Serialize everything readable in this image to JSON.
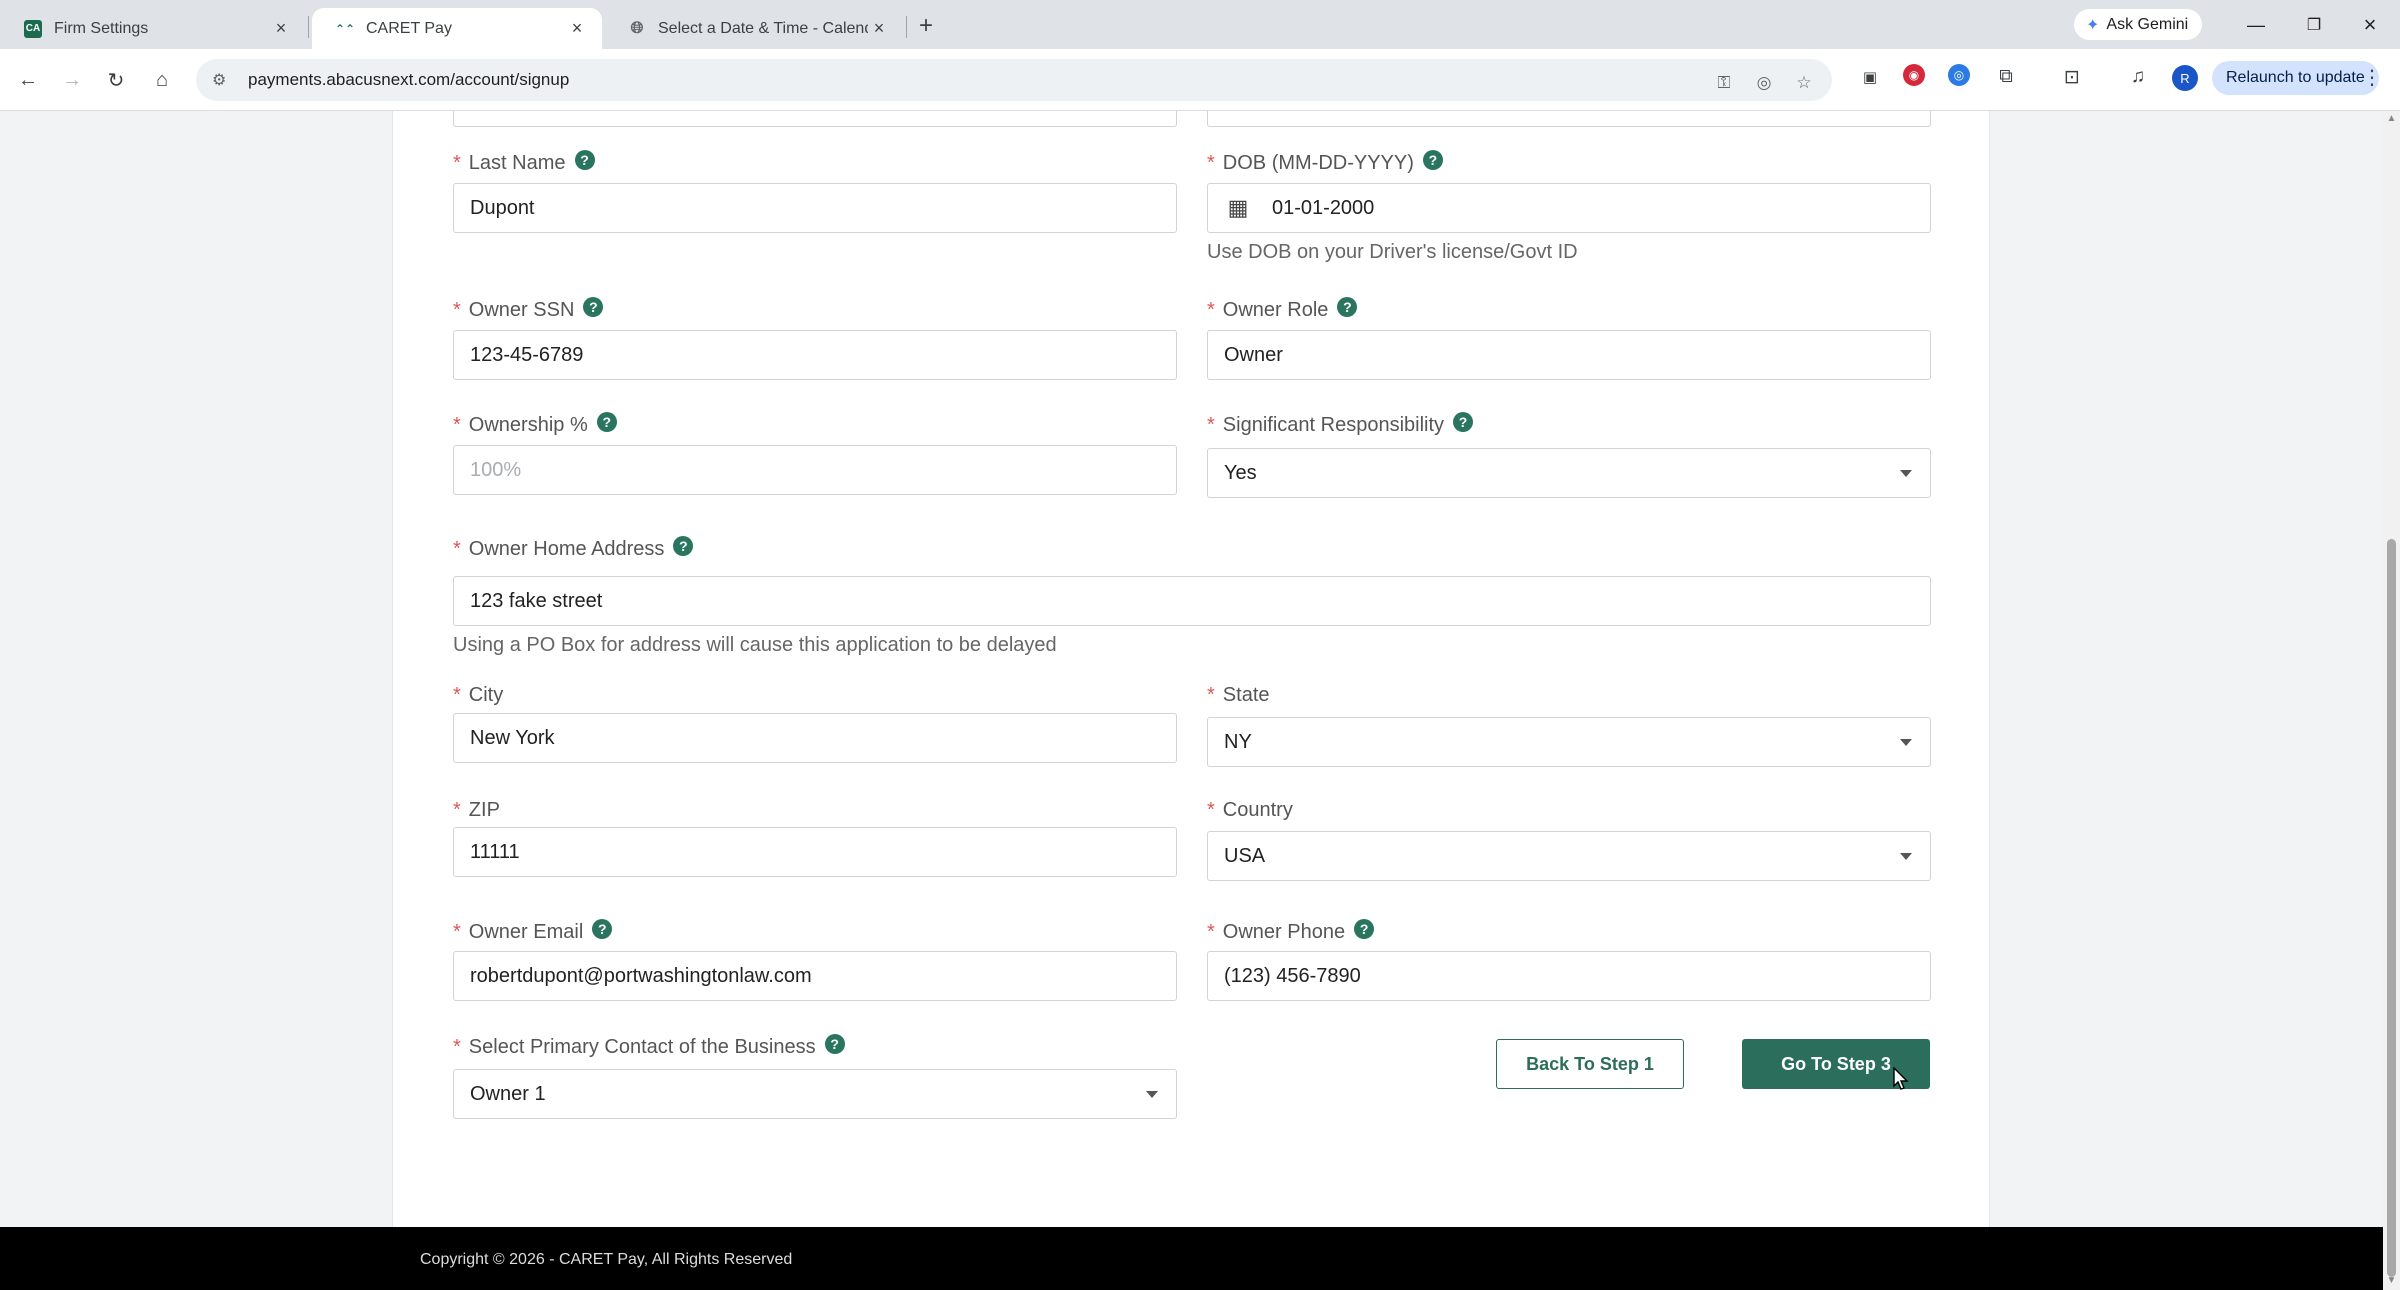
{
  "browser": {
    "tabs": [
      {
        "title": "Firm Settings",
        "favicon": "CA"
      },
      {
        "title": "CARET Pay",
        "favicon": "caret"
      },
      {
        "title": "Select a Date & Time - Calendly",
        "favicon": "globe"
      }
    ],
    "gemini_label": "Ask Gemini",
    "url": "payments.abacusnext.com/account/signup",
    "avatar_letter": "R",
    "relaunch_label": "Relaunch to update"
  },
  "form": {
    "last_name": {
      "label": "Last Name",
      "value": "Dupont"
    },
    "dob": {
      "label": "DOB (MM-DD-YYYY)",
      "value": "01-01-2000",
      "hint": "Use DOB on your Driver's license/Govt ID"
    },
    "owner_ssn": {
      "label": "Owner SSN",
      "value": "123-45-6789"
    },
    "owner_role": {
      "label": "Owner Role",
      "value": "Owner"
    },
    "ownership": {
      "label": "Ownership %",
      "placeholder": "100%"
    },
    "significant_responsibility": {
      "label": "Significant Responsibility",
      "value": "Yes"
    },
    "home_address": {
      "label": "Owner Home Address",
      "value": "123 fake street",
      "hint": "Using a PO Box for address will cause this application to be delayed"
    },
    "city": {
      "label": "City",
      "value": "New York"
    },
    "state": {
      "label": "State",
      "value": "NY"
    },
    "zip": {
      "label": "ZIP",
      "value": "11111"
    },
    "country": {
      "label": "Country",
      "value": "USA"
    },
    "owner_email": {
      "label": "Owner Email",
      "value": "robertdupont@portwashingtonlaw.com"
    },
    "owner_phone": {
      "label": "Owner Phone",
      "value": "(123) 456-7890"
    },
    "primary_contact": {
      "label": "Select Primary Contact of the Business",
      "value": "Owner 1"
    },
    "required_mark": "*",
    "help_glyph": "?"
  },
  "actions": {
    "back_label": "Back To Step 1",
    "next_label": "Go To Step 3"
  },
  "footer": {
    "copyright": "Copyright © 2026 - CARET Pay, All Rights Reserved"
  },
  "colors": {
    "accent": "#2a6e5b",
    "required": "#e05555",
    "footer_bg": "#000000"
  }
}
